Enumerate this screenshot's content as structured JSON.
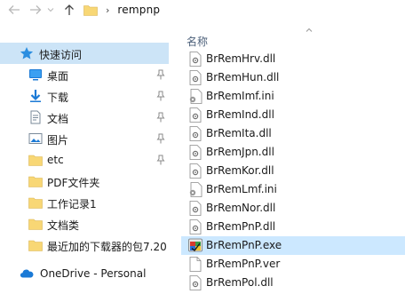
{
  "address": {
    "path": "rempnp",
    "separator": "›"
  },
  "nav_pane": {
    "quick_access": "快速访问",
    "items": [
      {
        "label": "桌面",
        "icon": "desktop-icon",
        "pinned": true
      },
      {
        "label": "下载",
        "icon": "download-icon",
        "pinned": true
      },
      {
        "label": "文档",
        "icon": "documents-icon",
        "pinned": true
      },
      {
        "label": "图片",
        "icon": "pictures-icon",
        "pinned": true
      },
      {
        "label": "etc",
        "icon": "folder-icon",
        "pinned": true
      },
      {
        "label": "PDF文件夹",
        "icon": "folder-icon",
        "pinned": false
      },
      {
        "label": "工作记录1",
        "icon": "folder-icon",
        "pinned": false
      },
      {
        "label": "文档类",
        "icon": "folder-icon",
        "pinned": false
      },
      {
        "label": "最近加的下载器的包7.20",
        "icon": "folder-icon",
        "pinned": false
      }
    ],
    "onedrive": "OneDrive - Personal"
  },
  "file_list": {
    "column_name": "名称",
    "files": [
      {
        "name": "BrRemHrv.dll",
        "type": "dll"
      },
      {
        "name": "BrRemHun.dll",
        "type": "dll"
      },
      {
        "name": "BrRemImf.ini",
        "type": "ini"
      },
      {
        "name": "BrRemInd.dll",
        "type": "dll"
      },
      {
        "name": "BrRemIta.dll",
        "type": "dll"
      },
      {
        "name": "BrRemJpn.dll",
        "type": "dll"
      },
      {
        "name": "BrRemKor.dll",
        "type": "dll"
      },
      {
        "name": "BrRemLmf.ini",
        "type": "ini"
      },
      {
        "name": "BrRemNor.dll",
        "type": "dll"
      },
      {
        "name": "BrRemPnP.dll",
        "type": "dll"
      },
      {
        "name": "BrRemPnP.exe",
        "type": "exe",
        "selected": true
      },
      {
        "name": "BrRemPnP.ver",
        "type": "ver"
      },
      {
        "name": "BrRemPol.dll",
        "type": "dll"
      }
    ]
  },
  "colors": {
    "selection_nav": "#cce4f7",
    "selection_file": "#cce8ff",
    "folder": "#f8d775",
    "header_text": "#4c607a"
  }
}
